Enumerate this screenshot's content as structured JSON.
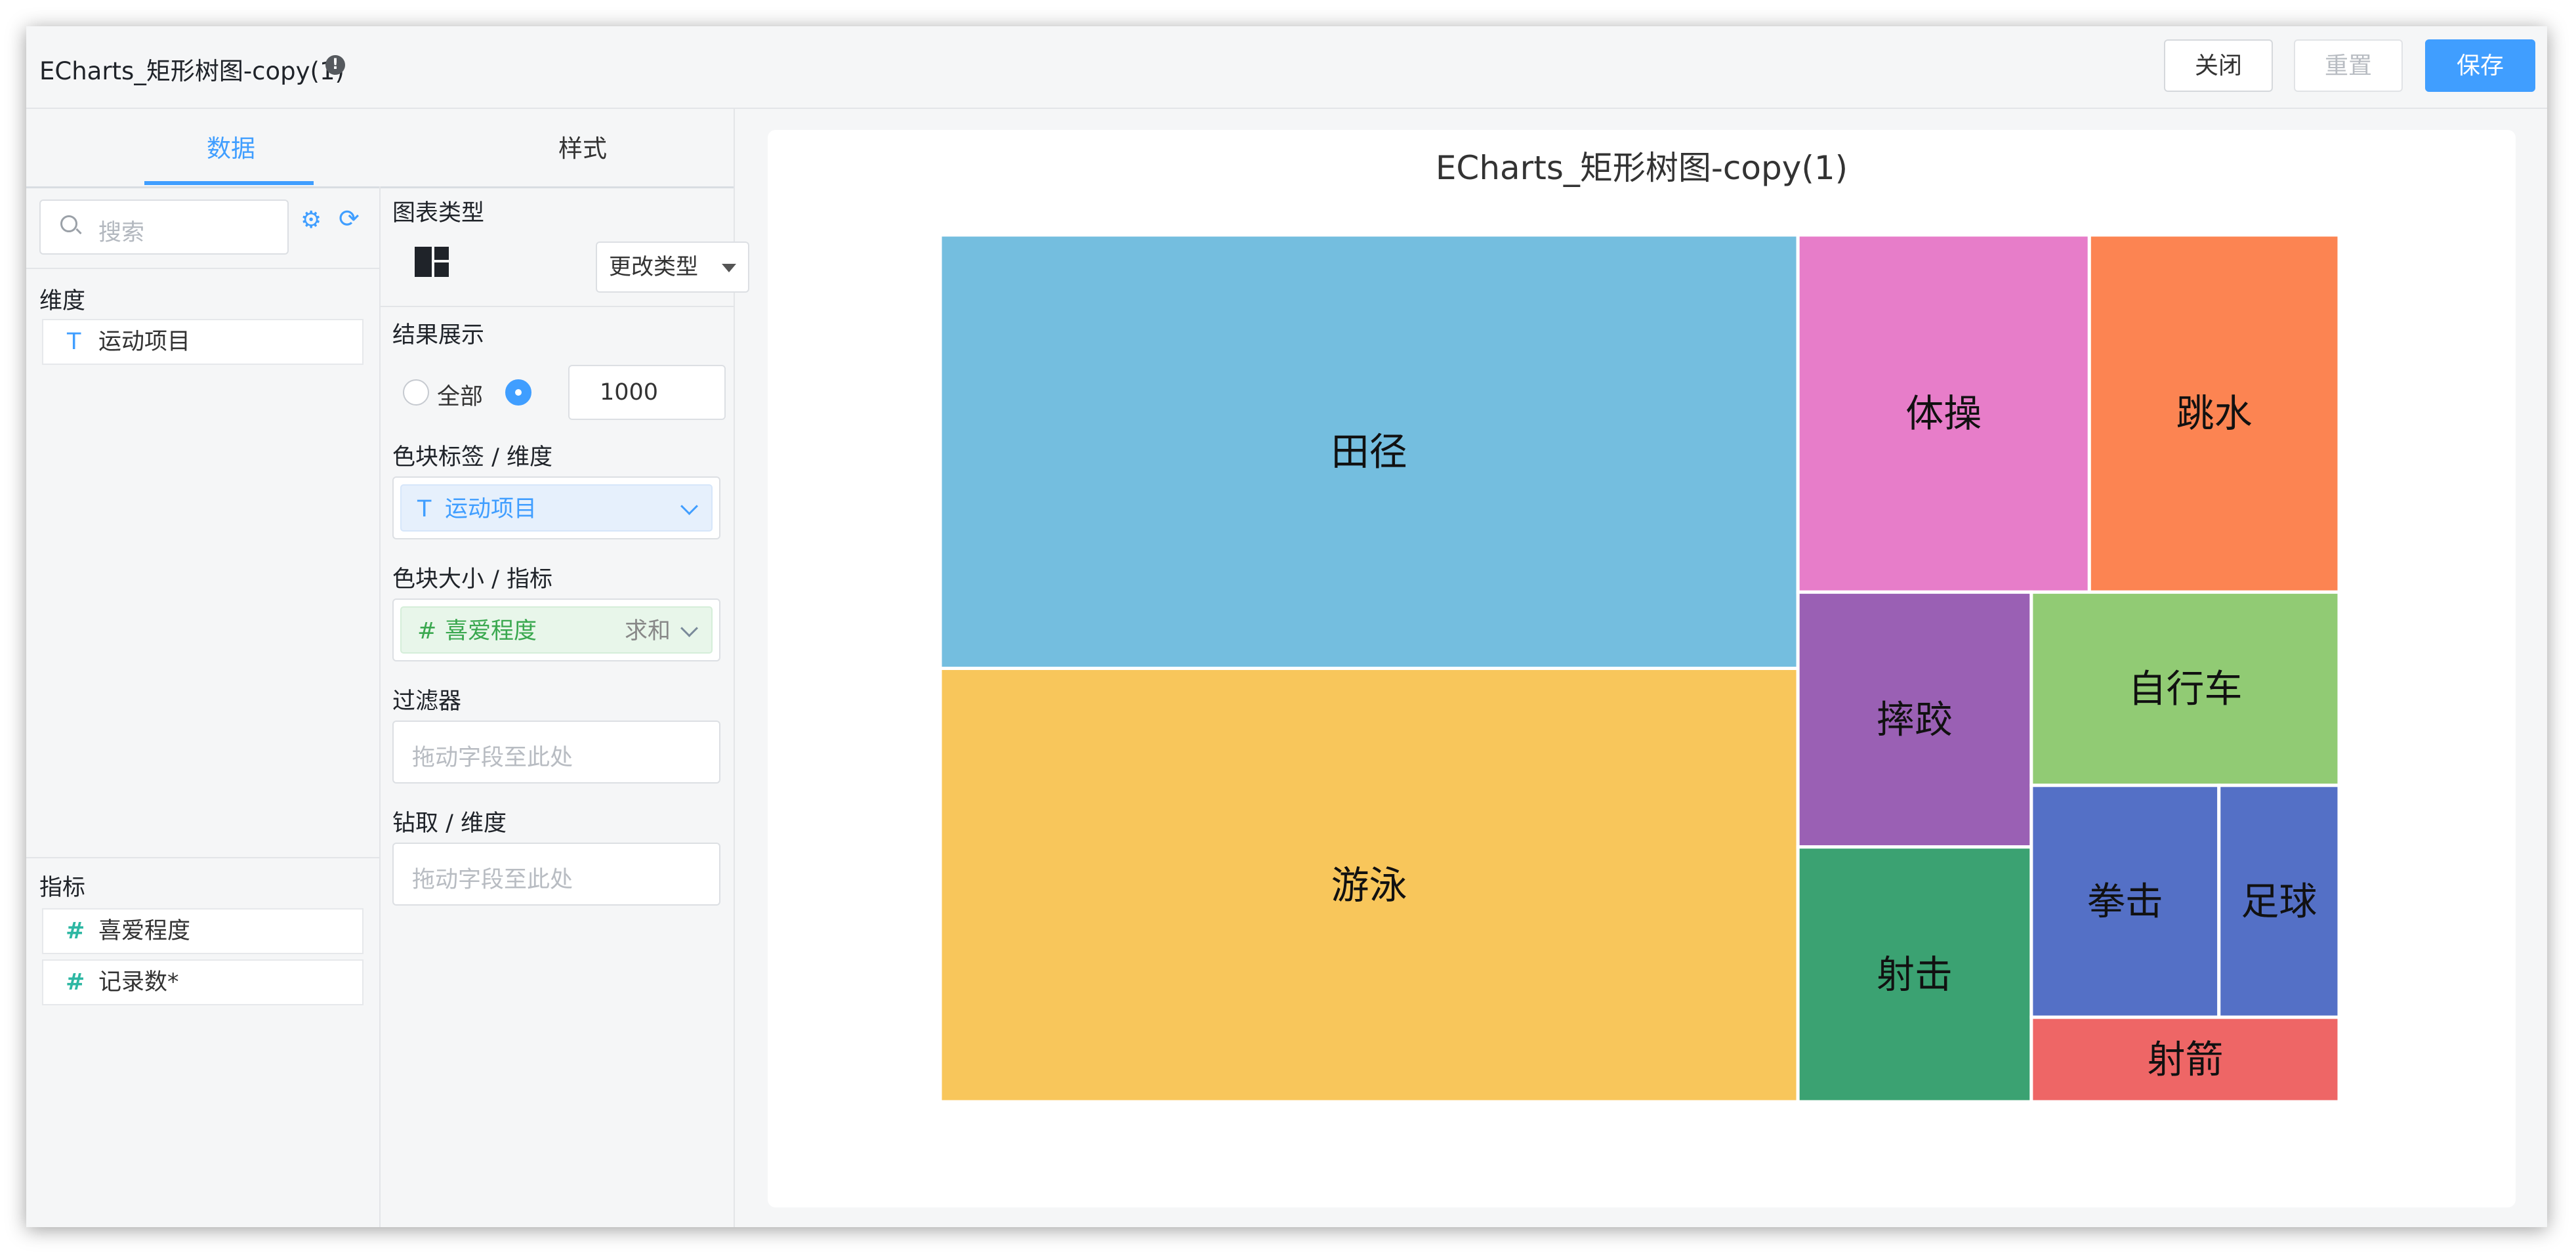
{
  "window": {
    "title": "ECharts_矩形树图-copy(1)",
    "info_icon": "!"
  },
  "buttons": {
    "close": "关闭",
    "reset": "重置",
    "save": "保存"
  },
  "tabs": {
    "data": "数据",
    "style": "样式"
  },
  "search": {
    "placeholder": "搜索",
    "gear_icon": "⚙",
    "refresh_icon": "⟳"
  },
  "dimensions": {
    "label": "维度",
    "items": [
      {
        "type": "T",
        "name": "运动项目"
      }
    ]
  },
  "metrics": {
    "label": "指标",
    "items": [
      {
        "type": "#",
        "name": "喜爱程度"
      },
      {
        "type": "#",
        "name": "记录数*"
      }
    ]
  },
  "config": {
    "chart_type_label": "图表类型",
    "change_type": "更改类型",
    "result_label": "结果展示",
    "result_all": "全部",
    "result_selected": "limit",
    "result_limit": "1000",
    "block_label_title": "色块标签 / 维度",
    "block_label_chip": {
      "type": "T",
      "name": "运动项目"
    },
    "block_size_title": "色块大小 / 指标",
    "block_size_chip": {
      "type": "#",
      "name": "喜爱程度",
      "agg": "求和"
    },
    "filter_title": "过滤器",
    "filter_placeholder": "拖动字段至此处",
    "drill_title": "钻取 / 维度",
    "drill_placeholder": "拖动字段至此处"
  },
  "colors": {
    "accent": "#409eff",
    "metric_green": "#3aa84f"
  },
  "chart_data": {
    "type": "treemap",
    "title": "ECharts_矩形树图-copy(1)",
    "labels": [
      "田径",
      "游泳",
      "体操",
      "跳水",
      "摔跤",
      "拳击",
      "射击",
      "足球",
      "自行车",
      "射箭"
    ],
    "values": [
      100,
      100,
      28,
      24,
      16,
      11.7,
      16,
      7.5,
      16,
      7
    ],
    "colors": [
      "#74bedf",
      "#f8c65b",
      "#e77dc9",
      "#fc8452",
      "#9a60b4",
      "#5470c6",
      "#3ba272",
      "#5470c6",
      "#91cb74",
      "#ee6666"
    ]
  }
}
